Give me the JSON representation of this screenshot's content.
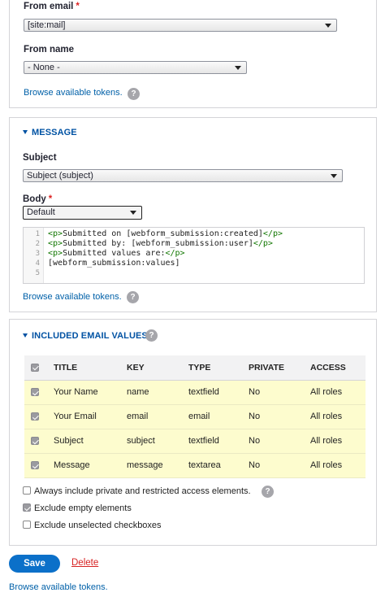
{
  "from_email": {
    "label": "From email",
    "value": "[site:mail]"
  },
  "from_name": {
    "label": "From name",
    "value": "- None -"
  },
  "browse_tokens_label": "Browse available tokens.",
  "help_glyph": "?",
  "message": {
    "title": "MESSAGE",
    "subject_label": "Subject",
    "subject_value": "Subject (subject)",
    "body_label": "Body",
    "body_format": "Default",
    "code_lines": [
      {
        "n": "1",
        "pre": "<p>",
        "text": "Submitted on [webform_submission:created]",
        "post": "</p>"
      },
      {
        "n": "2",
        "pre": "<p>",
        "text": "Submitted by: [webform_submission:user]",
        "post": "</p>"
      },
      {
        "n": "3",
        "pre": "<p>",
        "text": "Submitted values are:",
        "post": "</p>"
      },
      {
        "n": "4",
        "pre": "",
        "text": "[webform_submission:values]",
        "post": ""
      },
      {
        "n": "5",
        "pre": "",
        "text": "",
        "post": ""
      }
    ]
  },
  "included": {
    "title": "INCLUDED EMAIL VALUES",
    "headers": {
      "title": "TITLE",
      "key": "KEY",
      "type": "TYPE",
      "private": "PRIVATE",
      "access": "ACCESS"
    },
    "rows": [
      {
        "title": "Your Name",
        "key": "name",
        "type": "textfield",
        "private": "No",
        "access": "All roles"
      },
      {
        "title": "Your Email",
        "key": "email",
        "type": "email",
        "private": "No",
        "access": "All roles"
      },
      {
        "title": "Subject",
        "key": "subject",
        "type": "textfield",
        "private": "No",
        "access": "All roles"
      },
      {
        "title": "Message",
        "key": "message",
        "type": "textarea",
        "private": "No",
        "access": "All roles"
      }
    ],
    "options": {
      "always_private": "Always include private and restricted access elements.",
      "exclude_empty": "Exclude empty elements",
      "exclude_unselected": "Exclude unselected checkboxes"
    }
  },
  "actions": {
    "save": "Save",
    "delete": "Delete"
  }
}
